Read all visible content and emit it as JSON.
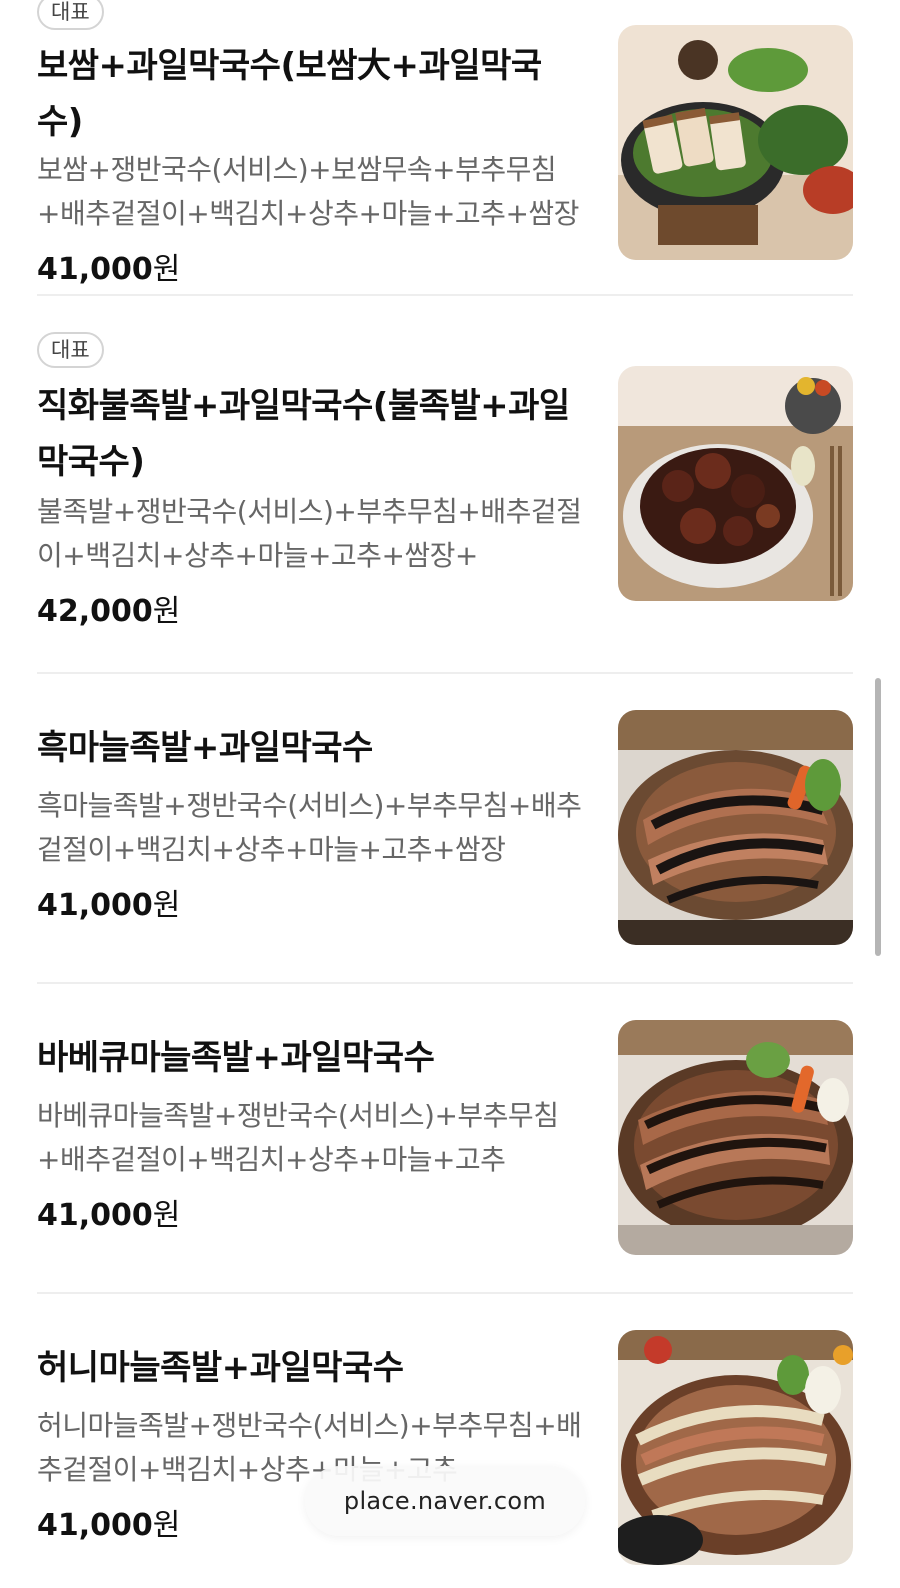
{
  "menu": {
    "items": [
      {
        "badge": "대표",
        "title": "보쌈+과일막국수(보쌈大+과일막국수)",
        "description": "보쌈+쟁반국수(서비스)+보쌈무속+부추무침+배추겉절이+백김치+상추+마늘+고추+쌈장",
        "price": "41,000",
        "currency": "원",
        "image_icon": "bossam-food-photo"
      },
      {
        "badge": "대표",
        "title": "직화불족발+과일막국수(불족발+과일막국수)",
        "description": "불족발+쟁반국수(서비스)+부추무침+배추겉절이+백김치+상추+마늘+고추+쌈장+",
        "price": "42,000",
        "currency": "원",
        "image_icon": "fire-jokbal-food-photo"
      },
      {
        "title": "흑마늘족발+과일막국수",
        "description": "흑마늘족발+쟁반국수(서비스)+부추무침+배추겉절이+백김치+상추+마늘+고추+쌈장",
        "price": "41,000",
        "currency": "원",
        "image_icon": "black-garlic-jokbal-food-photo"
      },
      {
        "title": "바베큐마늘족발+과일막국수",
        "description": "바베큐마늘족발+쟁반국수(서비스)+부추무침+배추겉절이+백김치+상추+마늘+고추",
        "price": "41,000",
        "currency": "원",
        "image_icon": "bbq-garlic-jokbal-food-photo"
      },
      {
        "title": "허니마늘족발+과일막국수",
        "description": "허니마늘족발+쟁반국수(서비스)+부추무침+배추겉절이+백김치+상추+마늘+고추",
        "price": "41,000",
        "currency": "원",
        "image_icon": "honey-garlic-jokbal-food-photo"
      }
    ]
  },
  "browser": {
    "url": "place.naver.com"
  },
  "colors": {
    "background": "#ffffff",
    "text_primary": "#111111",
    "text_secondary": "#666666",
    "divider": "#eeeeee"
  }
}
